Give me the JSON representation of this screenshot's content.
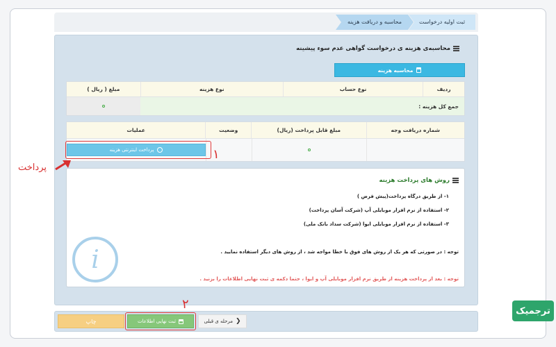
{
  "breadcrumbs": [
    "ثبت اولیه درخواست",
    "محاسبه و دریافت هزینه"
  ],
  "section_title": "محاسبه‌ی هزینه ی درخواست گواهی عدم سوء پیشینه",
  "calc_button": "محاسبه هزینه",
  "cost_table": {
    "headers": [
      "ردیف",
      "نوع حساب",
      "نوع هزینه",
      "مبلغ ( ریال )"
    ],
    "total_label": "جمع کل هزینه :"
  },
  "payment_table": {
    "headers": [
      "شماره دریافت وجه",
      "مبلغ قابل پرداخت (ریال)",
      "وضعیت",
      "عملیات"
    ],
    "pay_button": "پرداخت اینترنتی هزینه"
  },
  "payment_methods": {
    "title": "روش های پرداخت هزینه",
    "items": [
      "۱- از طریق درگاه پرداخت(پیش فرض )",
      "۲- استفاده از نرم افزار موبایلی آپ (شرکت آسان پرداخت)",
      "۳- استفاده از نرم افزار موبایلی ایوا (شرکت سداد بانک ملی)"
    ],
    "note": "توجه : در صورتی که هر یک از روش های فوق با خطا مواجه شد ، از روش های دیگر استفاده نمایید .",
    "warning": "توجه : بعد از پرداخت هزینه از طریق نرم افزار موبایلی آپ و ایوا ، حتما دکمه ی ثبت نهایی اطلاعات را بزنید ."
  },
  "footer": {
    "print": "چاپ",
    "final_submit": "ثبت نهایی اطلاعات",
    "previous": "مرحله ی قبلی"
  },
  "annotations": {
    "pay_label": "پرداخت",
    "step1": "۱",
    "step2": "۲"
  },
  "brand": "ترجمیک",
  "colors": {
    "accent_blue": "#3bb8e2",
    "green": "#86c77a",
    "orange": "#f6cf82",
    "annotation_red": "#e03a3a",
    "brand_green": "#2ea56b"
  }
}
